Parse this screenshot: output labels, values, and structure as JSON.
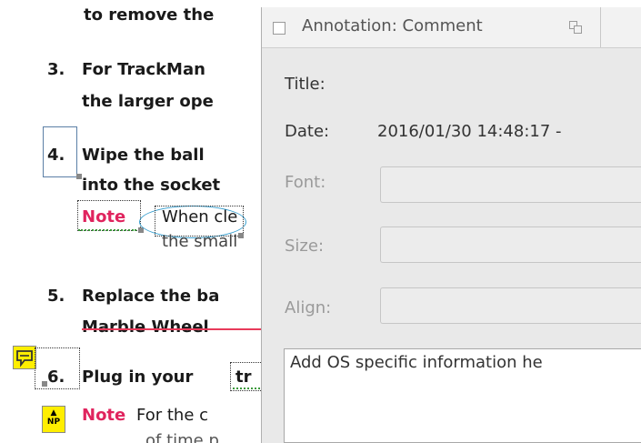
{
  "document": {
    "line_top": "to remove the",
    "step3": {
      "number": "3.",
      "line1": "For TrackMan",
      "line2": "the larger ope"
    },
    "step4": {
      "number": "4.",
      "line1": "Wipe the ball",
      "line2": "into the socket"
    },
    "note1": {
      "label": "Note",
      "line1": "When cle",
      "line2": "the small"
    },
    "step5": {
      "number": "5.",
      "line1": "Replace the ba",
      "line2": "Marble Wheel"
    },
    "step6": {
      "number": "6.",
      "prefix": "Plug in your",
      "suffix": "tr"
    },
    "note2": {
      "label": "Note",
      "line1": "For the c",
      "line2": "of time p"
    },
    "icons": {
      "comment": "comment-note-icon",
      "new_paragraph": "new-paragraph-icon",
      "np_text": "NP"
    }
  },
  "dialog": {
    "title": "Annotation: Comment",
    "fields": {
      "title_label": "Title:",
      "date_label": "Date:",
      "date_value": "2016/01/30 14:48:17 -",
      "font_label": "Font:",
      "size_label": "Size:",
      "align_label": "Align:"
    },
    "comment_text": "Add OS specific information he"
  },
  "colors": {
    "note_label": "#e0245e",
    "highlight_ellipse": "#3aa0d0",
    "annotation_yellow": "#ffee00",
    "strike_red": "#e83a5a",
    "underline_green": "#3b9a3b"
  }
}
